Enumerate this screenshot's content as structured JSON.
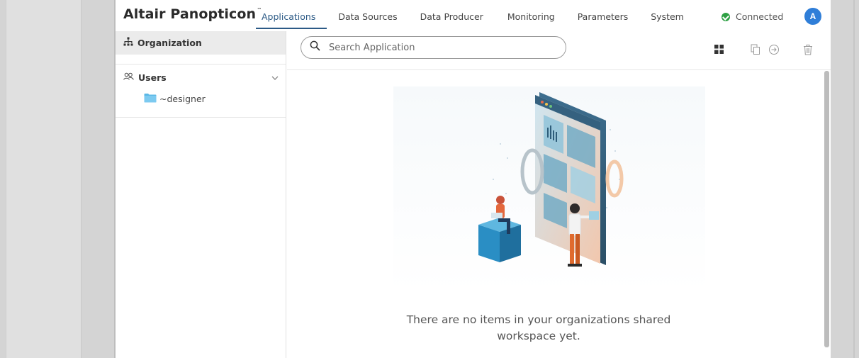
{
  "app": {
    "brand": "Altair Panopticon",
    "brand_mark": "™"
  },
  "nav": {
    "items": [
      {
        "label": "Applications",
        "active": true
      },
      {
        "label": "Data Sources",
        "active": false
      },
      {
        "label": "Data Producer",
        "active": false
      },
      {
        "label": "Monitoring",
        "active": false
      },
      {
        "label": "Parameters",
        "active": false
      },
      {
        "label": "System",
        "active": false
      }
    ]
  },
  "status": {
    "label": "Connected",
    "color": "#2ea043"
  },
  "user": {
    "initial": "A",
    "color": "#2f7ed8"
  },
  "sidebar": {
    "header": "Organization",
    "group": "Users",
    "folders": [
      {
        "label": "~designer"
      }
    ]
  },
  "search": {
    "placeholder": "Search Application",
    "value": ""
  },
  "toolbar": {
    "icons": [
      "grid-view-icon",
      "copy-icon",
      "move-icon",
      "delete-icon"
    ]
  },
  "empty_state": {
    "line1": "There are no items in your organizations shared",
    "line2": "workspace yet."
  },
  "colors": {
    "accent": "#2c5a86",
    "folder": "#5bb8e6"
  }
}
